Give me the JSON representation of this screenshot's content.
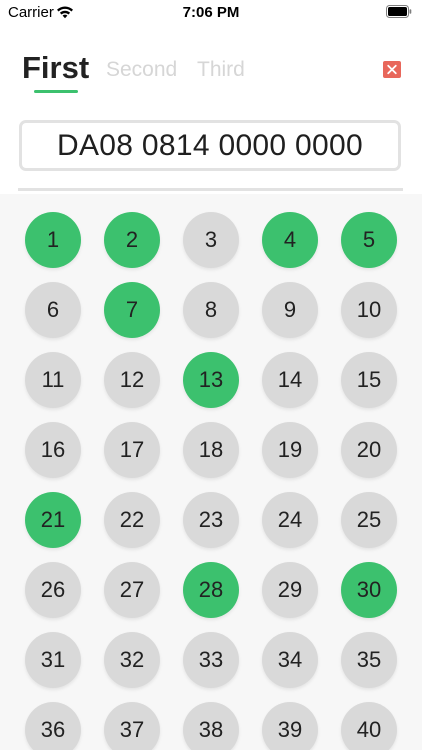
{
  "status_bar": {
    "carrier": "Carrier",
    "time": "7:06 PM"
  },
  "tabs": [
    {
      "label": "First",
      "active": true
    },
    {
      "label": "Second",
      "active": false
    },
    {
      "label": "Third",
      "active": false
    }
  ],
  "code": "DA08 0814 0000 0000",
  "colors": {
    "accent": "#3cc16e",
    "inactive_ball": "#d9d9d9",
    "close": "#e8675b",
    "inactive_tab": "#d6d6d6"
  },
  "icons": {
    "close": "close-icon",
    "wifi": "wifi-icon",
    "battery": "battery-icon"
  },
  "numbers": [
    {
      "label": "1",
      "selected": true
    },
    {
      "label": "2",
      "selected": true
    },
    {
      "label": "3",
      "selected": false
    },
    {
      "label": "4",
      "selected": true
    },
    {
      "label": "5",
      "selected": true
    },
    {
      "label": "6",
      "selected": false
    },
    {
      "label": "7",
      "selected": true
    },
    {
      "label": "8",
      "selected": false
    },
    {
      "label": "9",
      "selected": false
    },
    {
      "label": "10",
      "selected": false
    },
    {
      "label": "11",
      "selected": false
    },
    {
      "label": "12",
      "selected": false
    },
    {
      "label": "13",
      "selected": true
    },
    {
      "label": "14",
      "selected": false
    },
    {
      "label": "15",
      "selected": false
    },
    {
      "label": "16",
      "selected": false
    },
    {
      "label": "17",
      "selected": false
    },
    {
      "label": "18",
      "selected": false
    },
    {
      "label": "19",
      "selected": false
    },
    {
      "label": "20",
      "selected": false
    },
    {
      "label": "21",
      "selected": true
    },
    {
      "label": "22",
      "selected": false
    },
    {
      "label": "23",
      "selected": false
    },
    {
      "label": "24",
      "selected": false
    },
    {
      "label": "25",
      "selected": false
    },
    {
      "label": "26",
      "selected": false
    },
    {
      "label": "27",
      "selected": false
    },
    {
      "label": "28",
      "selected": true
    },
    {
      "label": "29",
      "selected": false
    },
    {
      "label": "30",
      "selected": true
    },
    {
      "label": "31",
      "selected": false
    },
    {
      "label": "32",
      "selected": false
    },
    {
      "label": "33",
      "selected": false
    },
    {
      "label": "34",
      "selected": false
    },
    {
      "label": "35",
      "selected": false
    },
    {
      "label": "36",
      "selected": false
    },
    {
      "label": "37",
      "selected": false
    },
    {
      "label": "38",
      "selected": false
    },
    {
      "label": "39",
      "selected": false
    },
    {
      "label": "40",
      "selected": false
    }
  ]
}
